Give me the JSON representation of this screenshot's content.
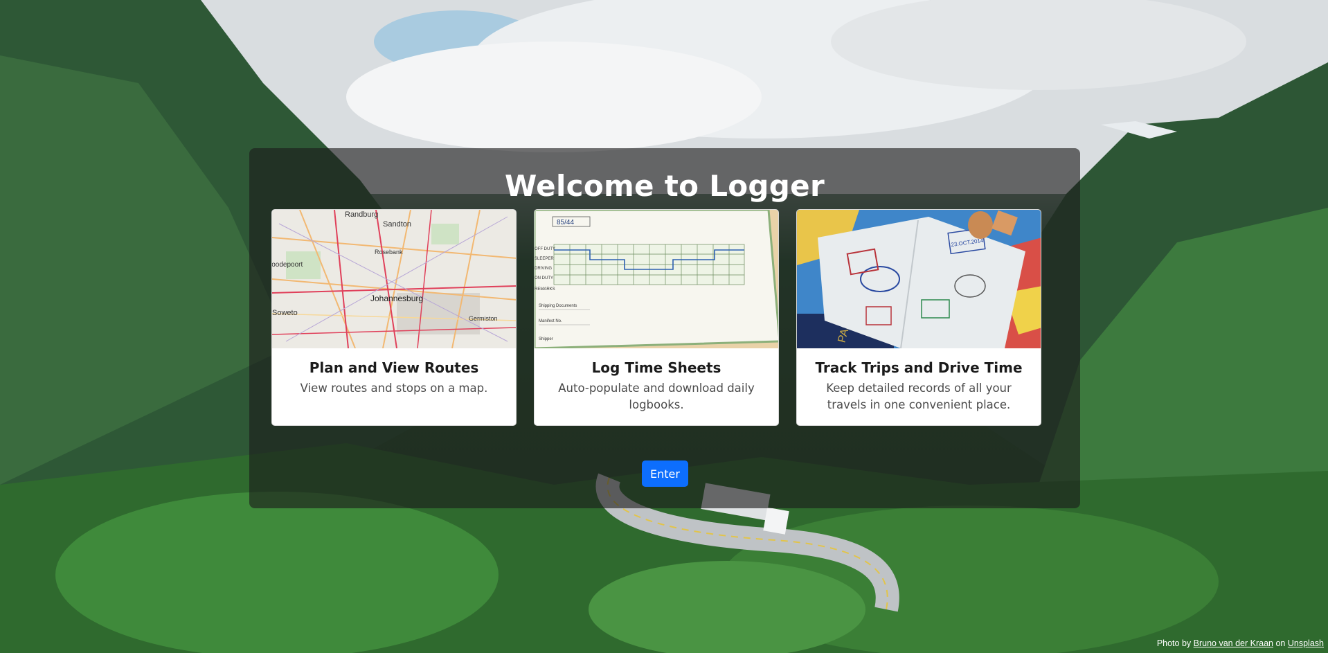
{
  "page": {
    "title": "Welcome to Logger",
    "enter_label": "Enter"
  },
  "cards": [
    {
      "title": "Plan and View Routes",
      "text": "View routes and stops on a map.",
      "image_labels": [
        "Randburg",
        "Sandton",
        "Rosebank",
        "Johannesburg",
        "Germiston",
        "Soweto",
        "Roodepoort"
      ]
    },
    {
      "title": "Log Time Sheets",
      "text": "Auto-populate and download daily logbooks.",
      "image_labels": [
        "85/44",
        "OFF DUTY",
        "SLEEPER",
        "DRIVING",
        "ON DUTY",
        "REMARKS",
        "Shipping Documents",
        "Manifest No.",
        "Shipper"
      ]
    },
    {
      "title": "Track Trips and Drive Time",
      "text": "Keep detailed records of all your travels in one convenient place.",
      "image_labels": [
        "23.OCT.2014",
        "PASSPORT"
      ]
    }
  ],
  "credit": {
    "prefix": "Photo by",
    "author": "Bruno van der Kraan",
    "middle": "on",
    "source": "Unsplash"
  },
  "colors": {
    "accent": "#0d6efd",
    "overlay": "rgba(28,28,28,0.62)"
  }
}
